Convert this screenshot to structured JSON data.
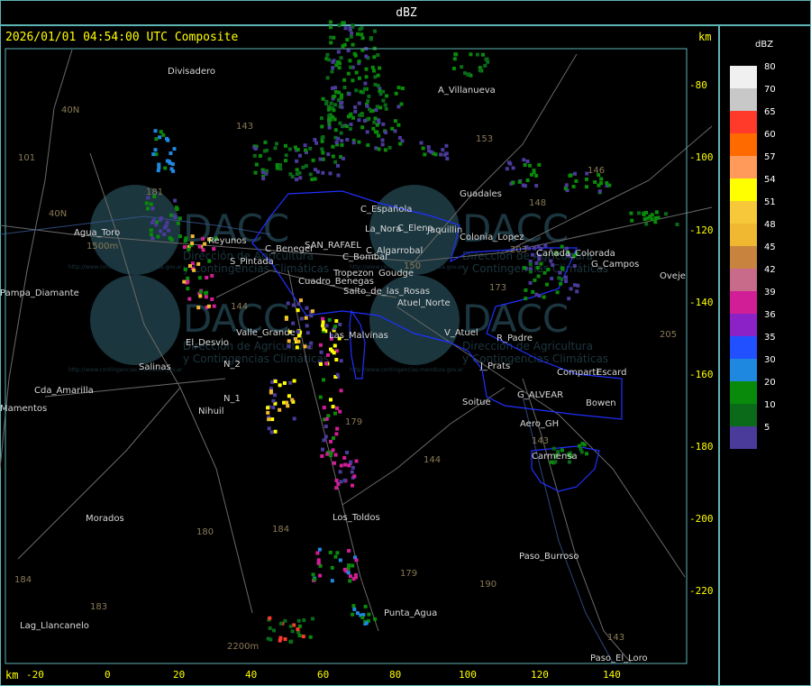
{
  "header": {
    "title": "dBZ"
  },
  "map": {
    "timestamp": "2026/01/01 04:54:00 UTC Composite",
    "km_label_top": "km",
    "km_label_bottom": "km",
    "x_ticks": [
      "-20",
      "0",
      "20",
      "40",
      "60",
      "80",
      "100",
      "120",
      "140"
    ],
    "y_ticks": [
      "-80",
      "-100",
      "-120",
      "-140",
      "-160",
      "-180",
      "-200",
      "-220"
    ],
    "watermark": {
      "brand": "DACC",
      "line1": "Dirección de Agricultura",
      "line2": "y Contingencias Climáticas",
      "url": "http://www.contingencias.mendoza.gov.ar"
    },
    "places": [
      "Divisadero",
      "A_Villanueva",
      "Guadales",
      "Agua_Toro",
      "Pampa_Diamante",
      "Reyunos",
      "S_Pintada",
      "C_Beneger",
      "SAN_RAFAEL",
      "C_Algarrobal",
      "C_Bombal",
      "Tropezon",
      "Goudge",
      "La_Nora",
      "Cuadro_Benegas",
      "Salto_de_las_Rosas",
      "Atuel_Norte",
      "C_Elena",
      "C_Española",
      "Jaquillin",
      "Colonia_Lopez",
      "El_Desvio",
      "Valle_Grande",
      "Las_Malvinas",
      "V_Atuel",
      "R_Padre",
      "J_Prats",
      "Comparti",
      "Escard",
      "G_ALVEAR",
      "Bowen",
      "Salinas",
      "Cda_Amarilla",
      "Mamentos",
      "N_1",
      "N_2",
      "Nihuil",
      "Soitue",
      "Aero_GH",
      "Carmensa",
      "Morados",
      "Los_Toldos",
      "Paso_Burroso",
      "Punta_Agua",
      "Lag_Llancanelo",
      "Paso_El_Loro",
      "G_Campos",
      "Oveje",
      "Cañada_Colorada"
    ],
    "routes": [
      "40N",
      "101",
      "40N",
      "1500m",
      "144",
      "143",
      "153",
      "146",
      "148",
      "203",
      "180",
      "184",
      "183",
      "184",
      "179",
      "179",
      "190",
      "143",
      "143",
      "205",
      "173",
      "2200m",
      "150",
      "144",
      "181"
    ]
  },
  "legend": {
    "title": "dBZ",
    "bins": [
      {
        "label": "80",
        "color": "#f0f0f0"
      },
      {
        "label": "70",
        "color": "#c8c8c8"
      },
      {
        "label": "65",
        "color": "#ff3a2a"
      },
      {
        "label": "60",
        "color": "#ff6a00"
      },
      {
        "label": "57",
        "color": "#ff9a5a"
      },
      {
        "label": "54",
        "color": "#ffff00"
      },
      {
        "label": "51",
        "color": "#f7c83a"
      },
      {
        "label": "48",
        "color": "#f0b830"
      },
      {
        "label": "45",
        "color": "#c8843e"
      },
      {
        "label": "42",
        "color": "#c86a8a"
      },
      {
        "label": "39",
        "color": "#d21e96"
      },
      {
        "label": "36",
        "color": "#8a22c8"
      },
      {
        "label": "35",
        "color": "#2050ff"
      },
      {
        "label": "30",
        "color": "#1e88e0"
      },
      {
        "label": "20",
        "color": "#0a8a0a"
      },
      {
        "label": "10",
        "color": "#0a6a1a"
      },
      {
        "label": "5",
        "color": "#4a3a9a"
      }
    ]
  }
}
